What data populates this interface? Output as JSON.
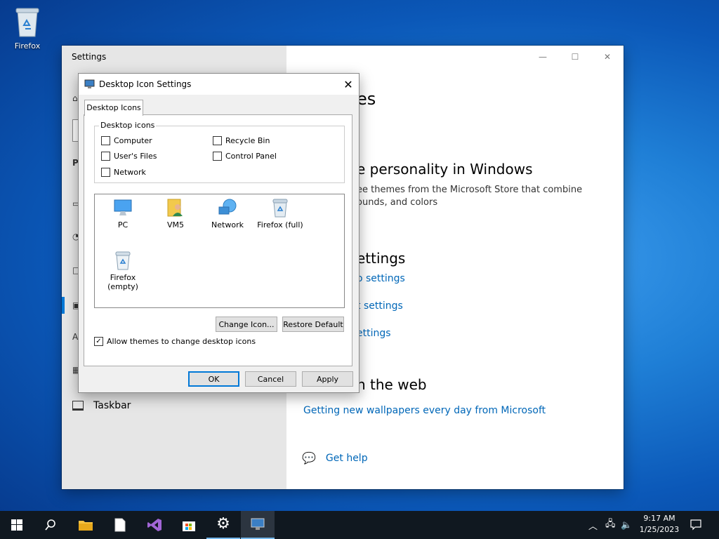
{
  "desktop": {
    "icon_label": "Firefox"
  },
  "settings": {
    "title": "Settings",
    "taskbar_label": "Taskbar",
    "heading_partial": "es",
    "section1": "e personality in Windows",
    "section1_text_a": "ee themes from the Microsoft Store that combine",
    "section1_text_b": "ounds, and colors",
    "section2": "ettings",
    "link1": "o settings",
    "link2": "t settings",
    "link3": "ettings",
    "section3": "n the web",
    "wallpaper_link": "Getting new wallpapers every day from Microsoft",
    "help_link": "Get help"
  },
  "dialog": {
    "title": "Desktop Icon Settings",
    "tab": "Desktop Icons",
    "group_label": "Desktop icons",
    "checkboxes": [
      {
        "label": "Computer",
        "checked": false
      },
      {
        "label": "Recycle Bin",
        "checked": false
      },
      {
        "label": "User's Files",
        "checked": false
      },
      {
        "label": "Control Panel",
        "checked": false
      },
      {
        "label": "Network",
        "checked": false
      }
    ],
    "icons": [
      "PC",
      "VM5",
      "Network",
      "Firefox (full)",
      "Firefox (empty)"
    ],
    "change_icon": "Change Icon...",
    "restore_default": "Restore Default",
    "allow_themes": "Allow themes to change desktop icons",
    "allow_themes_checked": true,
    "ok": "OK",
    "cancel": "Cancel",
    "apply": "Apply"
  },
  "taskbar": {
    "time": "9:17 AM",
    "date": "1/25/2023"
  }
}
